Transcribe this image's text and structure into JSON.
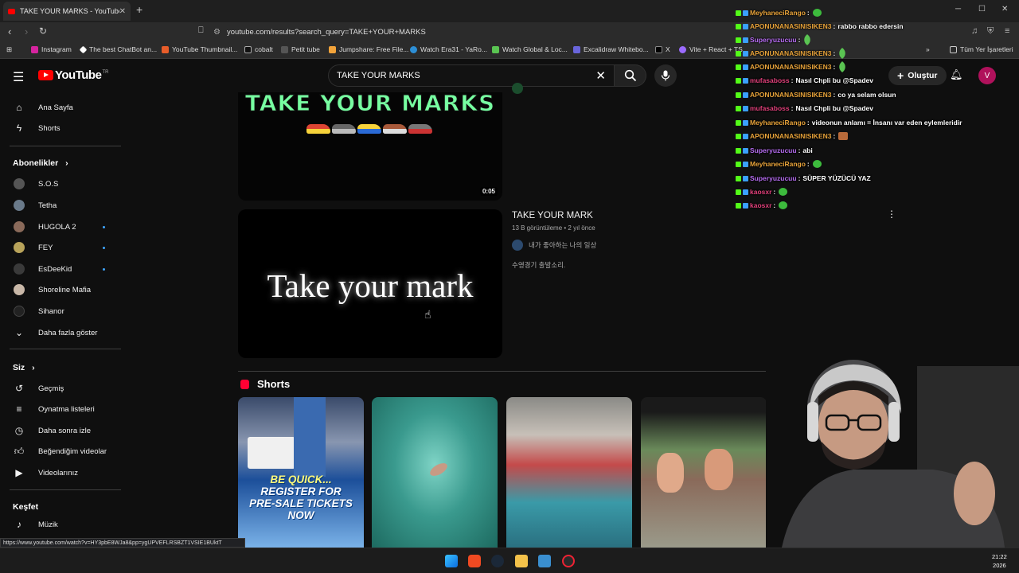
{
  "browser": {
    "tab_title": "TAKE YOUR MARKS - YouTube",
    "url": "youtube.com/results?search_query=TAKE+YOUR+MARKS",
    "bookmarks": [
      "Instagram",
      "The best ChatBot an...",
      "YouTube Thumbnail...",
      "cobalt",
      "Petit tube",
      "Jumpshare: Free File...",
      "Watch Era31 - YaRo...",
      "Watch Global & Loc...",
      "Excalidraw Whitebo...",
      "X",
      "Vite + React + TS",
      "Tüm Yer İşaretleri"
    ]
  },
  "youtube": {
    "logo": "YouTube",
    "logo_region": "TR",
    "search_value": "TAKE YOUR MARKS",
    "create_label": "Oluştur",
    "avatar_letter": "V"
  },
  "sidebar": {
    "home": "Ana Sayfa",
    "shorts": "Shorts",
    "subs_title": "Abonelikler",
    "channels": [
      {
        "name": "S.O.S",
        "color": "#555555",
        "dot": false
      },
      {
        "name": "Tetha",
        "color": "#6a7a8a",
        "dot": false
      },
      {
        "name": "HUGOLA 2",
        "color": "#8a6a5a",
        "dot": true
      },
      {
        "name": "FEY",
        "color": "#b8a35a",
        "dot": true
      },
      {
        "name": "EsDeeKid",
        "color": "#3a3a3a",
        "dot": true
      },
      {
        "name": "Shoreline Mafia",
        "color": "#c9b8a8",
        "dot": false
      },
      {
        "name": "Sihanor",
        "color": "#222222",
        "dot": false
      }
    ],
    "show_more": "Daha fazla göster",
    "you_title": "Siz",
    "you_items": [
      "Geçmiş",
      "Oynatma listeleri",
      "Daha sonra izle",
      "Beğendiğim videolar",
      "Videolarınız"
    ],
    "explore_title": "Keşfet",
    "explore_items": [
      "Müzik"
    ]
  },
  "results": {
    "video1": {
      "thumb_text": "TAKE YOUR MARKS",
      "duration": "0:05"
    },
    "video2": {
      "thumb_text": "Take your mark",
      "title": "TAKE YOUR MARK",
      "meta": "13 B görüntüleme • 2 yıl önce",
      "channel": "내가 좋아하는 나의 일상",
      "description": "수영경기 출발소리."
    },
    "shorts_title": "Shorts",
    "short_promo": [
      "BE QUICK...",
      "REGISTER FOR",
      "PRE-SALE TICKETS",
      "NOW"
    ]
  },
  "status_url": "https://www.youtube.com/watch?v=HY3pbE8WJa8&pp=ygUPVEFLRSBZT1VSIE1BUktT",
  "chat": {
    "messages": [
      {
        "user": "MeyhaneciRango",
        "color": "#e8a33a",
        "text": "",
        "emote": "green"
      },
      {
        "user": "APONUNANASINISIKEN3",
        "color": "#e8a33a",
        "text": "rabbo rabbo edersin",
        "emote": ""
      },
      {
        "user": "Superyuzucuu",
        "color": "#b56cf0",
        "text": "",
        "emote": "feather"
      },
      {
        "user": "APONUNANASINISIKEN3",
        "color": "#e8a33a",
        "text": "",
        "emote": "feather"
      },
      {
        "user": "APONUNANASINISIKEN3",
        "color": "#e8a33a",
        "text": "",
        "emote": "feather"
      },
      {
        "user": "mufasaboss",
        "color": "#e0407a",
        "text": "Nasıl Chpli bu @Spadev",
        "emote": ""
      },
      {
        "user": "APONUNANASINISIKEN3",
        "color": "#e8a33a",
        "text": "co ya selam olsun",
        "emote": ""
      },
      {
        "user": "mufasaboss",
        "color": "#e0407a",
        "text": "Nasıl Chpli bu @Spadev",
        "emote": ""
      },
      {
        "user": "MeyhaneciRango",
        "color": "#e8a33a",
        "text": "videonun anlamı = İnsanı var eden eylemleridir",
        "emote": ""
      },
      {
        "user": "APONUNANASINISIKEN3",
        "color": "#e8a33a",
        "text": "",
        "emote": "brown"
      },
      {
        "user": "Superyuzucuu",
        "color": "#b56cf0",
        "text": "abi",
        "emote": ""
      },
      {
        "user": "MeyhaneciRango",
        "color": "#e8a33a",
        "text": "",
        "emote": "green"
      },
      {
        "user": "Superyuzucuu",
        "color": "#b56cf0",
        "text": "SÜPER YÜZÜCÜ YAZ",
        "emote": ""
      },
      {
        "user": "kaosxr",
        "color": "#e0407a",
        "text": "",
        "emote": "green"
      },
      {
        "user": "kaosxr",
        "color": "#e0407a",
        "text": "",
        "emote": "green"
      }
    ]
  },
  "taskbar": {
    "time": "21:22",
    "year": "2026"
  }
}
